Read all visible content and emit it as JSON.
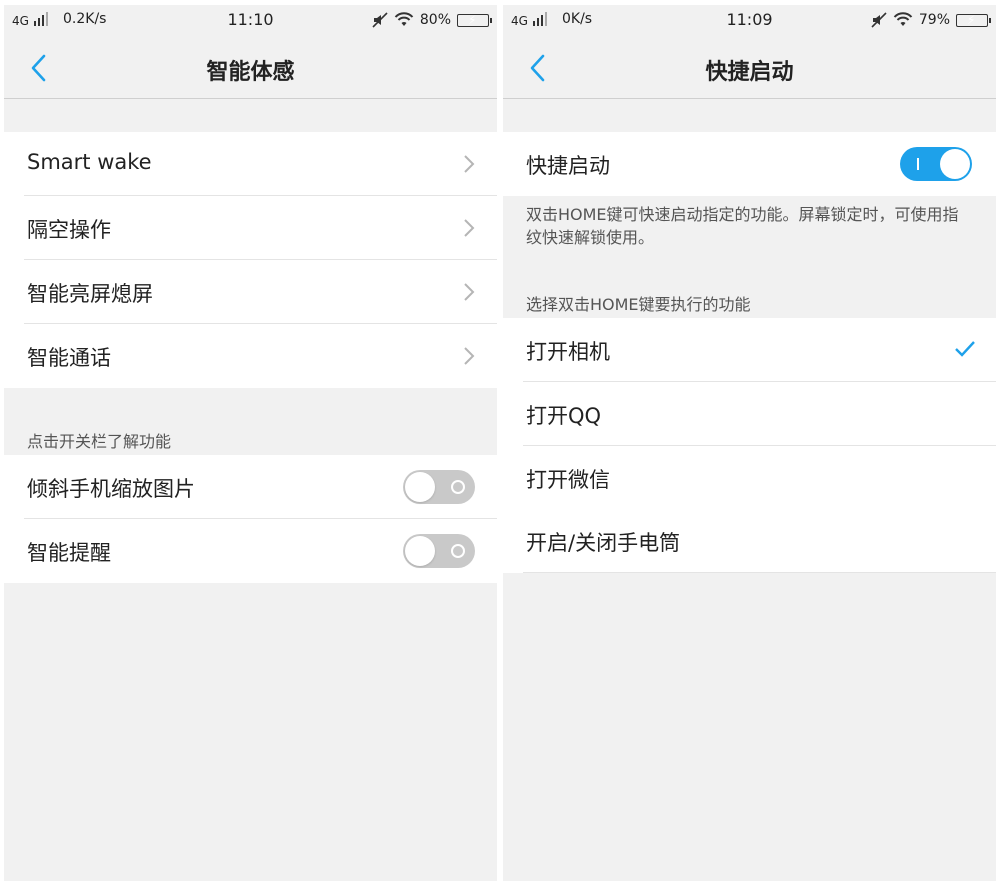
{
  "colors": {
    "accent": "#1ea1ea",
    "background": "#f1f1f1",
    "toggle_off": "#c9c9c9"
  },
  "left": {
    "status": {
      "network": "4G",
      "speed": "0.2K/s",
      "time": "11:10",
      "battery": "80%",
      "battery_level": 0.8
    },
    "title": "智能体感",
    "items": [
      {
        "label": "Smart wake"
      },
      {
        "label": "隔空操作"
      },
      {
        "label": "智能亮屏熄屏"
      },
      {
        "label": "智能通话"
      }
    ],
    "toggle_section_caption": "点击开关栏了解功能",
    "toggles": [
      {
        "label": "倾斜手机缩放图片",
        "on": false
      },
      {
        "label": "智能提醒",
        "on": false
      }
    ]
  },
  "right": {
    "status": {
      "network": "4G",
      "speed": "0K/s",
      "time": "11:09",
      "battery": "79%",
      "battery_level": 0.79
    },
    "title": "快捷启动",
    "main_toggle": {
      "label": "快捷启动",
      "on": true
    },
    "description": "双击HOME键可快速启动指定的功能。屏幕锁定时，可使用指纹快速解锁使用。",
    "options_caption": "选择双击HOME键要执行的功能",
    "options": [
      {
        "label": "打开相机",
        "selected": true
      },
      {
        "label": "打开QQ",
        "selected": false
      },
      {
        "label": "打开微信",
        "selected": false
      },
      {
        "label": "开启/关闭手电筒",
        "selected": false
      }
    ]
  }
}
